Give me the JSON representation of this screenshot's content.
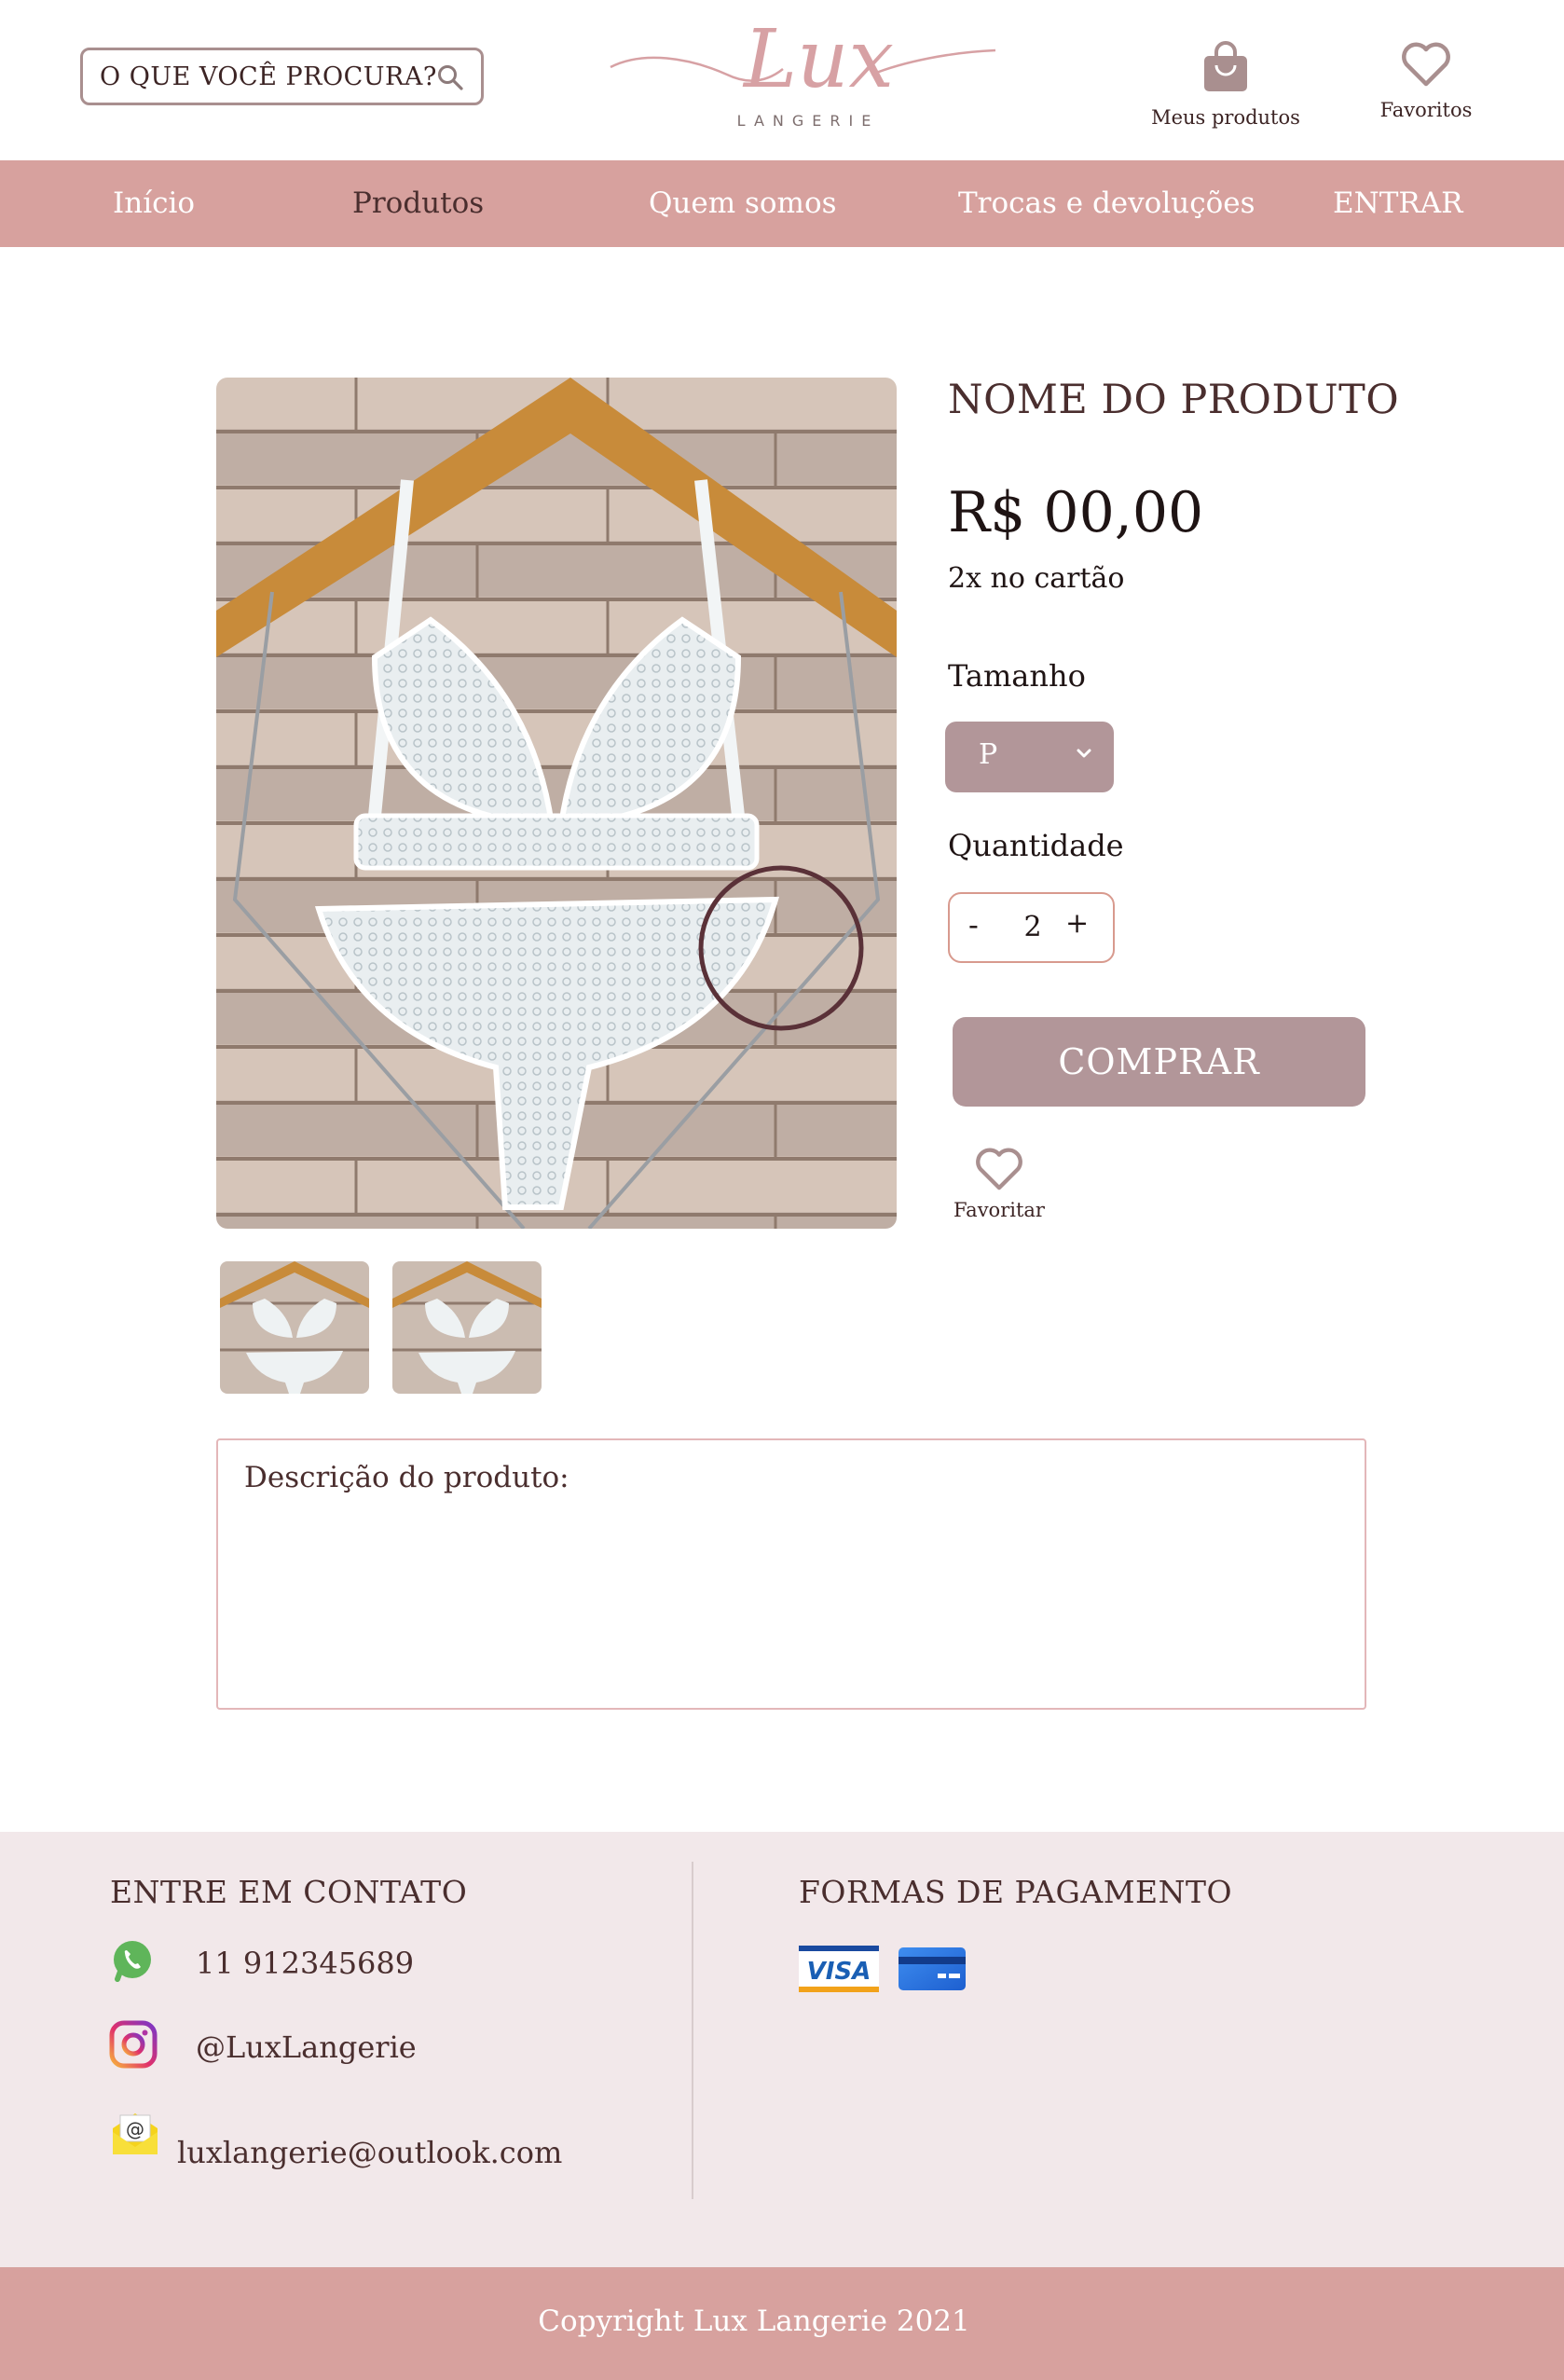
{
  "brand": {
    "logo_script": "Lux",
    "logo_sub": "LANGERIE"
  },
  "header": {
    "search_placeholder": "O QUE VOCÊ PROCURA?",
    "my_products_label": "Meus produtos",
    "favorites_label": "Favoritos"
  },
  "nav": {
    "items": [
      {
        "label": "Início"
      },
      {
        "label": "Produtos"
      },
      {
        "label": "Quem somos"
      },
      {
        "label": "Trocas e devoluções"
      },
      {
        "label": "ENTRAR"
      }
    ],
    "active": "Produtos"
  },
  "product": {
    "name": "NOME DO PRODUTO",
    "price": "R$ 00,00",
    "installments": "2x no cartão",
    "size_label": "Tamanho",
    "size_value": "P",
    "quantity_label": "Quantidade",
    "quantity_minus": "-",
    "quantity_value": "2",
    "quantity_plus": "+",
    "buy_label": "COMPRAR",
    "favorite_label": "Favoritar",
    "description_title": "Descrição do produto:"
  },
  "footer": {
    "contact_title": "ENTRE EM CONTATO",
    "phone": "11 912345689",
    "instagram": "@LuxLangerie",
    "email": "luxlangerie@outlook.com",
    "payment_title": "FORMAS DE PAGAMENTO",
    "payment_methods": [
      "VISA",
      "card"
    ],
    "copyright": "Copyright Lux Langerie 2021"
  },
  "colors": {
    "nav_bg": "#d7a19e",
    "button_bg": "#b29699",
    "footer_bg": "#f2e8ea",
    "text_dark": "#4a2e2e"
  },
  "icons": [
    "search-icon",
    "shopping-bag-icon",
    "heart-icon",
    "chevron-down-icon",
    "whatsapp-icon",
    "instagram-icon",
    "email-icon",
    "visa-icon",
    "credit-card-icon"
  ]
}
